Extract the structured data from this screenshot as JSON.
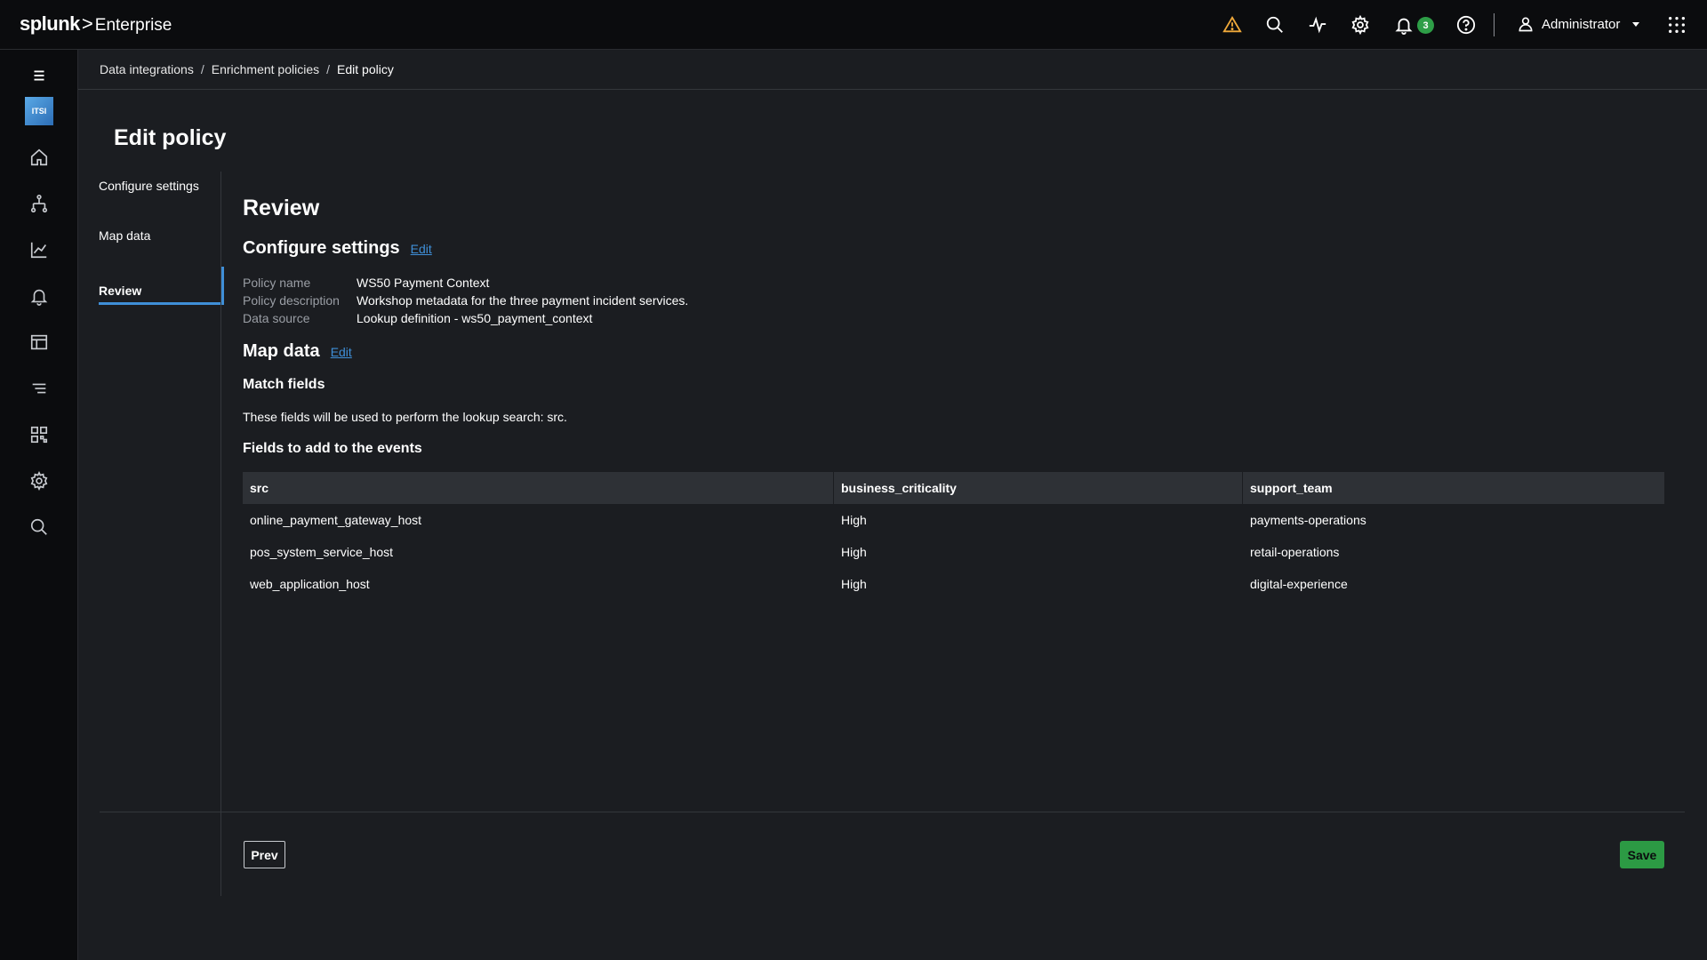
{
  "header": {
    "brand": "splunk",
    "separator": ">",
    "product": "Enterprise",
    "notification_count": "3",
    "user_name": "Administrator"
  },
  "breadcrumb": {
    "items": [
      "Data integrations",
      "Enrichment policies",
      "Edit policy"
    ],
    "separator": "/"
  },
  "rail": {
    "app_logo_text": "ITSI"
  },
  "page_title": "Edit policy",
  "steps": [
    "Configure settings",
    "Map data",
    "Review"
  ],
  "review": {
    "title": "Review",
    "configure": {
      "heading": "Configure settings",
      "edit_label": "Edit",
      "fields": [
        {
          "key": "Policy name",
          "value": "WS50 Payment Context"
        },
        {
          "key": "Policy description",
          "value": "Workshop metadata for the three payment incident services."
        },
        {
          "key": "Data source",
          "value": "Lookup definition - ws50_payment_context"
        }
      ]
    },
    "map_data": {
      "heading": "Map data",
      "edit_label": "Edit",
      "match_heading": "Match fields",
      "match_desc": "These fields will be used to perform the lookup search: src.",
      "fields_heading": "Fields to add to the events",
      "table": {
        "columns": [
          "src",
          "business_criticality",
          "support_team"
        ],
        "rows": [
          [
            "online_payment_gateway_host",
            "High",
            "payments-operations"
          ],
          [
            "pos_system_service_host",
            "High",
            "retail-operations"
          ],
          [
            "web_application_host",
            "High",
            "digital-experience"
          ]
        ]
      }
    }
  },
  "footer": {
    "prev_label": "Prev",
    "save_label": "Save"
  },
  "colors": {
    "accent": "#3f8fd8",
    "save": "#2c9a44",
    "warning": "#f0a93a",
    "badge": "#2e9e47"
  }
}
